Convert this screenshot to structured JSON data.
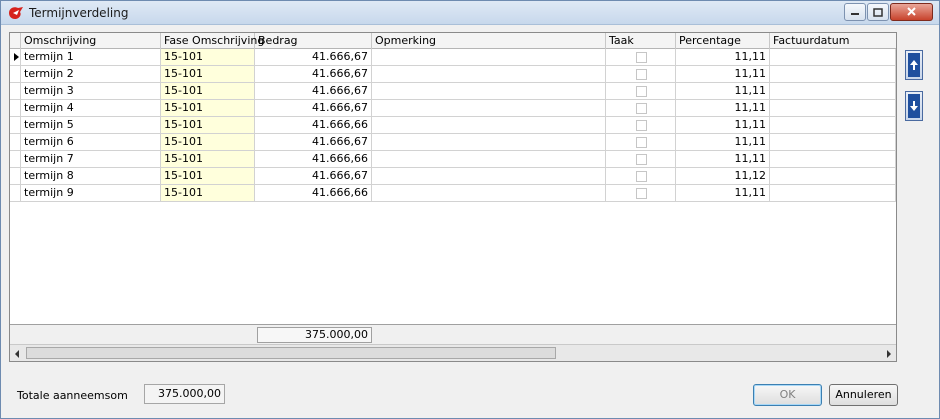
{
  "window": {
    "title": "Termijnverdeling",
    "icon": "app-logo-icon"
  },
  "grid": {
    "columns": [
      "Omschrijving",
      "Fase Omschrijving",
      "Bedrag",
      "Opmerking",
      "Taak",
      "Percentage",
      "Factuurdatum"
    ],
    "rows": [
      {
        "omschrijving": "termijn 1",
        "fase": "15-101",
        "bedrag": "41.666,67",
        "opmerking": "",
        "taak": false,
        "percentage": "11,11",
        "factuurdatum": ""
      },
      {
        "omschrijving": "termijn 2",
        "fase": "15-101",
        "bedrag": "41.666,67",
        "opmerking": "",
        "taak": false,
        "percentage": "11,11",
        "factuurdatum": ""
      },
      {
        "omschrijving": "termijn 3",
        "fase": "15-101",
        "bedrag": "41.666,67",
        "opmerking": "",
        "taak": false,
        "percentage": "11,11",
        "factuurdatum": ""
      },
      {
        "omschrijving": "termijn 4",
        "fase": "15-101",
        "bedrag": "41.666,67",
        "opmerking": "",
        "taak": false,
        "percentage": "11,11",
        "factuurdatum": ""
      },
      {
        "omschrijving": "termijn 5",
        "fase": "15-101",
        "bedrag": "41.666,66",
        "opmerking": "",
        "taak": false,
        "percentage": "11,11",
        "factuurdatum": ""
      },
      {
        "omschrijving": "termijn 6",
        "fase": "15-101",
        "bedrag": "41.666,67",
        "opmerking": "",
        "taak": false,
        "percentage": "11,11",
        "factuurdatum": ""
      },
      {
        "omschrijving": "termijn 7",
        "fase": "15-101",
        "bedrag": "41.666,66",
        "opmerking": "",
        "taak": false,
        "percentage": "11,11",
        "factuurdatum": ""
      },
      {
        "omschrijving": "termijn 8",
        "fase": "15-101",
        "bedrag": "41.666,67",
        "opmerking": "",
        "taak": false,
        "percentage": "11,12",
        "factuurdatum": ""
      },
      {
        "omschrijving": "termijn 9",
        "fase": "15-101",
        "bedrag": "41.666,66",
        "opmerking": "",
        "taak": false,
        "percentage": "11,11",
        "factuurdatum": ""
      }
    ],
    "footer_total": "375.000,00"
  },
  "footer": {
    "totale_label": "Totale aanneemsom",
    "totale_value": "375.000,00",
    "ok_label": "OK",
    "cancel_label": "Annuleren"
  }
}
